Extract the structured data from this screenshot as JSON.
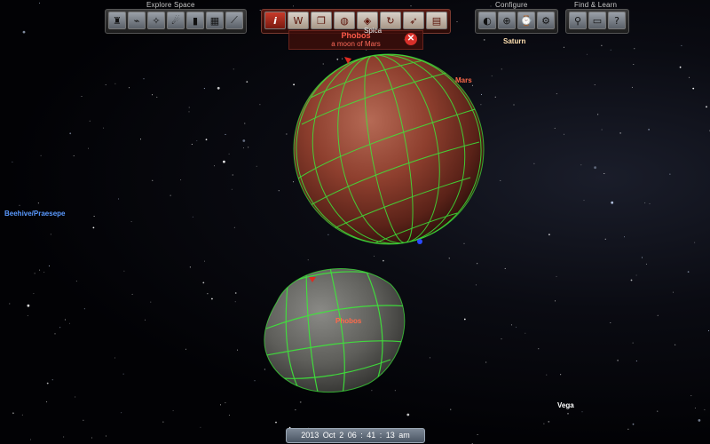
{
  "toolbar": {
    "explore_label": "Explore Space",
    "configure_label": "Configure",
    "find_label": "Find & Learn",
    "info_glyph": "i",
    "wiki_glyph": "W",
    "help_glyph": "?"
  },
  "info_panel": {
    "title": "Phobos",
    "subtitle": "a moon of Mars"
  },
  "labels": {
    "spica": "Spica",
    "saturn": "Saturn",
    "mars": "Mars",
    "beehive": "Beehive/Praesepe",
    "phobos": "Phobos",
    "vega": "Vega"
  },
  "datetime": {
    "display": "2013  Oct   2    06 : 41 : 13 am"
  },
  "colors": {
    "grid": "#3ee83a",
    "planet_label": "#ff6a4a",
    "star_label": "#ffe0b0",
    "dso_label": "#5a9aff",
    "accent_red": "#d8302a"
  }
}
